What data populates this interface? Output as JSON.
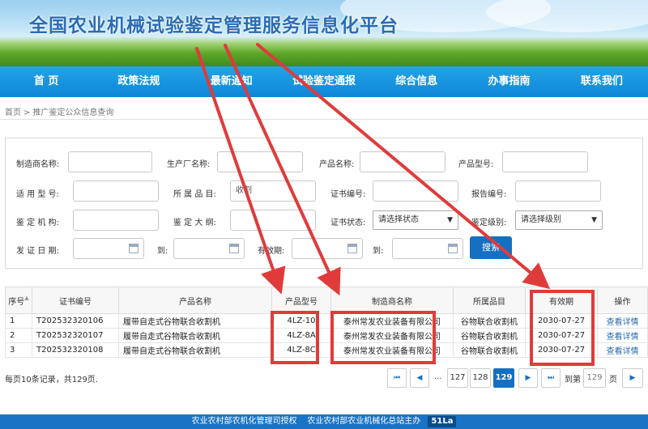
{
  "banner": {
    "title": "全国农业机械试验鉴定管理服务信息化平台"
  },
  "nav": [
    "首 页",
    "政策法规",
    "最新通知",
    "试验鉴定通报",
    "综合信息",
    "办事指南",
    "联系我们"
  ],
  "breadcrumb": {
    "home": "首页",
    "separator": ">",
    "current": "推广鉴定公众信息查询"
  },
  "form": {
    "labels": {
      "manufacturer": "制造商名称:",
      "producer": "生产厂名称:",
      "product_name": "产品名称:",
      "product_model": "产品型号:",
      "scope": "适 用 型 号:",
      "category": "所 属 品 目:",
      "cert_no": "证书编号:",
      "report_no": "报告编号:",
      "agency": "鉴 定 机 构:",
      "outline": "鉴 定 大 纲:",
      "cert_status": "证书状态:",
      "level": "鉴定级别:",
      "issue_date": "发 证 日 期:",
      "to1": "到:",
      "valid": "有效期:",
      "to2": "到:"
    },
    "values": {
      "category": "收割"
    },
    "selects": {
      "cert_status": "请选择状态",
      "level": "请选择级别"
    },
    "search_button": "搜索"
  },
  "table": {
    "headers": [
      "序号",
      "证书编号",
      "产品名称",
      "产品型号",
      "制造商名称",
      "所属品目",
      "有效期",
      "操作"
    ],
    "rows": [
      {
        "no": "1",
        "cert": "T202532320106",
        "name": "履带自走式谷物联合收割机",
        "model": "4LZ-10",
        "maker": "泰州常发农业装备有限公司",
        "category": "谷物联合收割机",
        "valid": "2030-07-27",
        "action": "查看详情"
      },
      {
        "no": "2",
        "cert": "T202532320107",
        "name": "履带自走式谷物联合收割机",
        "model": "4LZ-8A",
        "maker": "泰州常发农业装备有限公司",
        "category": "谷物联合收割机",
        "valid": "2030-07-27",
        "action": "查看详情"
      },
      {
        "no": "3",
        "cert": "T202532320108",
        "name": "履带自走式谷物联合收割机",
        "model": "4LZ-8C",
        "maker": "泰州常发农业装备有限公司",
        "category": "谷物联合收割机",
        "valid": "2030-07-27",
        "action": "查看详情"
      }
    ]
  },
  "pagination": {
    "summary": "每页10条记录，共129页.",
    "first": "⏮",
    "prev": "◀",
    "ellipsis": "...",
    "pages": [
      "127",
      "128",
      "129"
    ],
    "current": "129",
    "next": "▶",
    "last": "⏭",
    "goto_label": "到第",
    "goto_value": "129",
    "page_unit": "页",
    "go": "▶"
  },
  "footer": {
    "text1": "农业农村部农机化管理司授权",
    "text2": "农业农村部农业机械化总站主办",
    "badge": "51La"
  },
  "colors": {
    "nav": "#0d87d6",
    "annotation": "#e03b3b",
    "primary": "#1570c1"
  }
}
